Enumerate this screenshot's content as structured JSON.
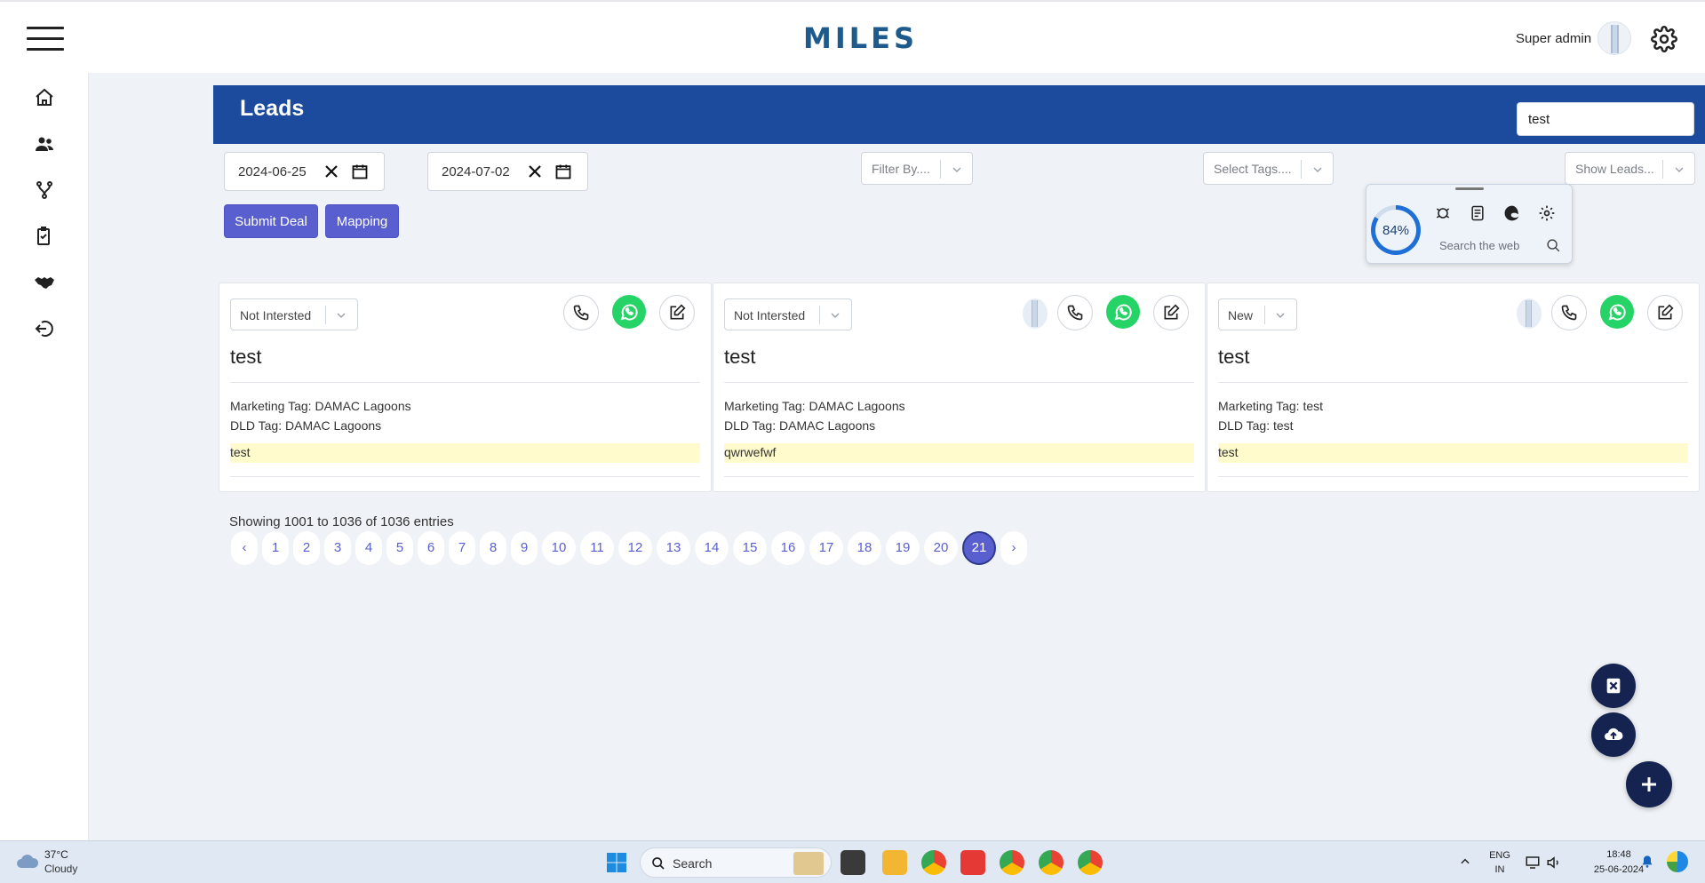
{
  "app": {
    "logo": "MILES",
    "user": "Super admin"
  },
  "page": {
    "title": "Leads",
    "search_value": "test"
  },
  "filters": {
    "date_from": "2024-06-25",
    "date_to": "2024-07-02",
    "filter_by": "Filter By....",
    "select_tags": "Select Tags....",
    "show_leads": "Show Leads..."
  },
  "actions": {
    "submit_deal": "Submit Deal",
    "mapping": "Mapping"
  },
  "widget": {
    "percent": "84%",
    "search_label": "Search the web"
  },
  "cards": [
    {
      "status": "Not Intersted",
      "name": "test",
      "marketing_tag": "Marketing Tag: DAMAC Lagoons",
      "dld_tag": "DLD Tag: DAMAC Lagoons",
      "note": "test"
    },
    {
      "status": "Not Intersted",
      "name": "test",
      "marketing_tag": "Marketing Tag: DAMAC Lagoons",
      "dld_tag": "DLD Tag: DAMAC Lagoons",
      "note": "qwrwefwf"
    },
    {
      "status": "New",
      "name": "test",
      "marketing_tag": "Marketing Tag: test",
      "dld_tag": "DLD Tag: test",
      "note": "test"
    }
  ],
  "pagination": {
    "summary": "Showing 1001 to 1036 of 1036 entries",
    "prev": "‹",
    "next": "›",
    "pages": [
      "1",
      "2",
      "3",
      "4",
      "5",
      "6",
      "7",
      "8",
      "9",
      "10",
      "11",
      "12",
      "13",
      "14",
      "15",
      "16",
      "17",
      "18",
      "19",
      "20",
      "21"
    ],
    "active": "21"
  },
  "taskbar": {
    "temperature": "37°C",
    "condition": "Cloudy",
    "search": "Search",
    "lang": "ENG",
    "region": "IN",
    "time": "18:48",
    "date": "25-06-2024"
  },
  "colors": {
    "brand_blue": "#1c4b9e",
    "button": "#5a5fd0",
    "fab": "#14234f",
    "whatsapp": "#25d366",
    "note_bg": "#fffbcc"
  }
}
